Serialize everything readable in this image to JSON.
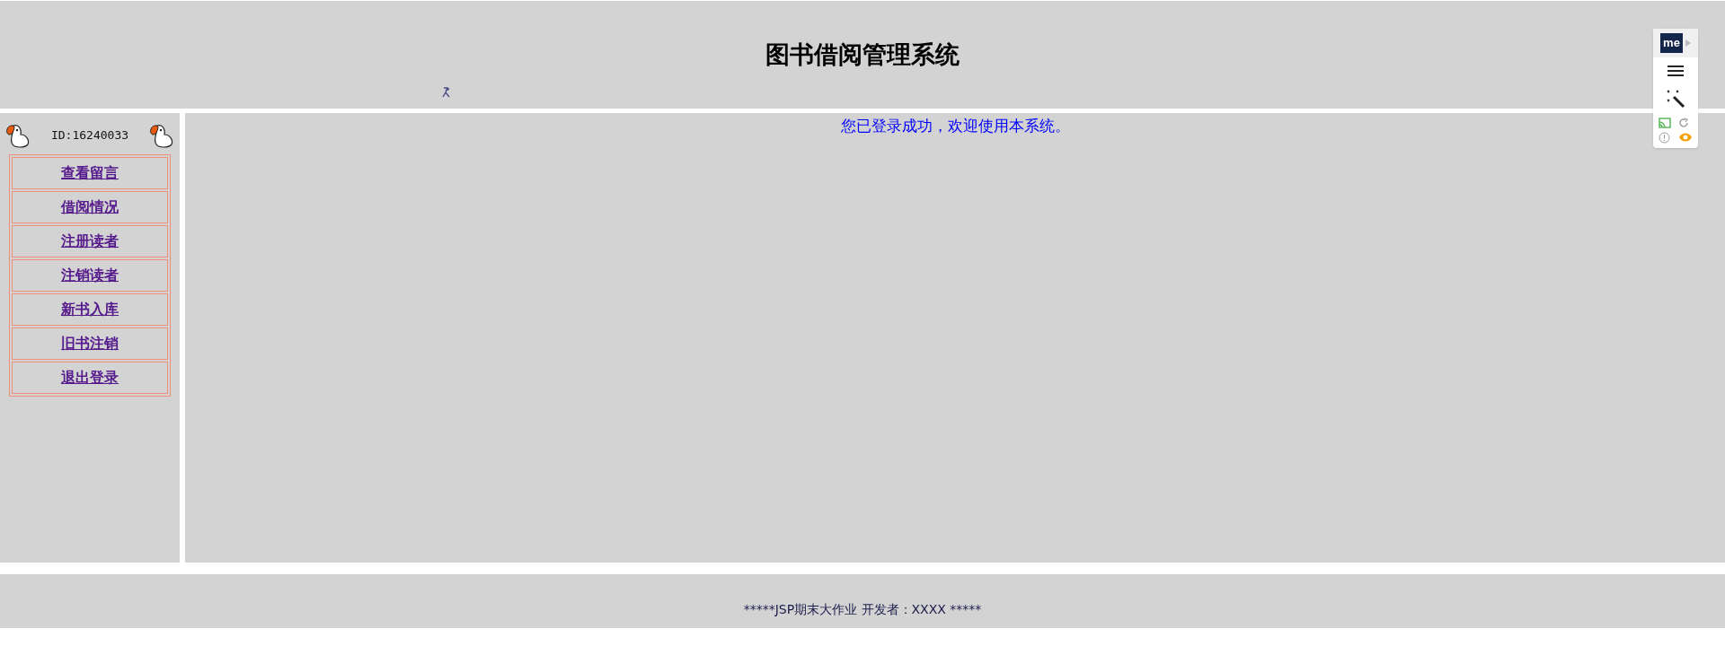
{
  "header": {
    "title": "图书借阅管理系统"
  },
  "sidebar": {
    "user_id": "ID:16240033",
    "menu": [
      {
        "label": "查看留言"
      },
      {
        "label": "借阅情况"
      },
      {
        "label": "注册读者"
      },
      {
        "label": "注销读者"
      },
      {
        "label": "新书入库"
      },
      {
        "label": "旧书注销"
      },
      {
        "label": "退出登录"
      }
    ]
  },
  "main": {
    "message": "您已登录成功，欢迎使用本系统。"
  },
  "footer": {
    "text": "*****JSP期末大作业 开发者：XXXX *****"
  },
  "extension_toolbar": {
    "logo": "me"
  }
}
